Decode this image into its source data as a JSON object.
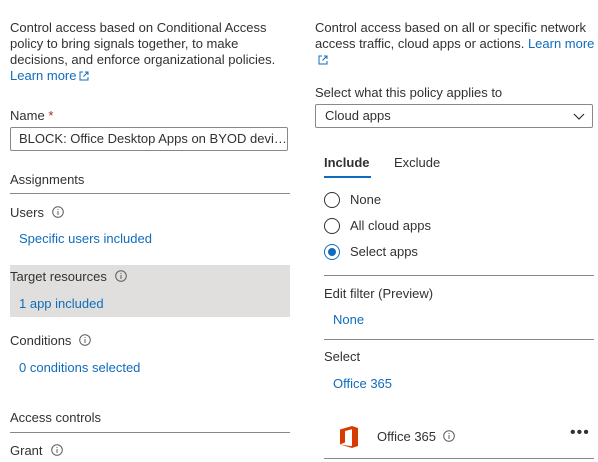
{
  "left": {
    "description": "Control access based on Conditional Access policy to bring signals together, to make decisions, and enforce organizational policies.",
    "learn_more": "Learn more",
    "name_label": "Name",
    "required_marker": "*",
    "name_value": "BLOCK: Office Desktop Apps on BYOD devices",
    "assignments_heading": "Assignments",
    "users_label": "Users",
    "users_value": "Specific users included",
    "target_label": "Target resources",
    "target_value": "1 app included",
    "conditions_label": "Conditions",
    "conditions_value": "0 conditions selected",
    "access_heading": "Access controls",
    "grant_label": "Grant"
  },
  "right": {
    "description": "Control access based on all or specific network access traffic, cloud apps or actions.",
    "learn_more": "Learn more",
    "applies_label": "Select what this policy applies to",
    "applies_value": "Cloud apps",
    "tabs": [
      "Include",
      "Exclude"
    ],
    "radios": [
      {
        "label": "None",
        "selected": false
      },
      {
        "label": "All cloud apps",
        "selected": false
      },
      {
        "label": "Select apps",
        "selected": true
      }
    ],
    "filter_label": "Edit filter (Preview)",
    "filter_value": "None",
    "select_label": "Select",
    "select_value": "Office 365",
    "app_name": "Office 365",
    "more_label": "•••"
  },
  "colors": {
    "link": "#0f6cbd",
    "selected_bg": "#e1dfdd",
    "office_red": "#d83b01"
  }
}
